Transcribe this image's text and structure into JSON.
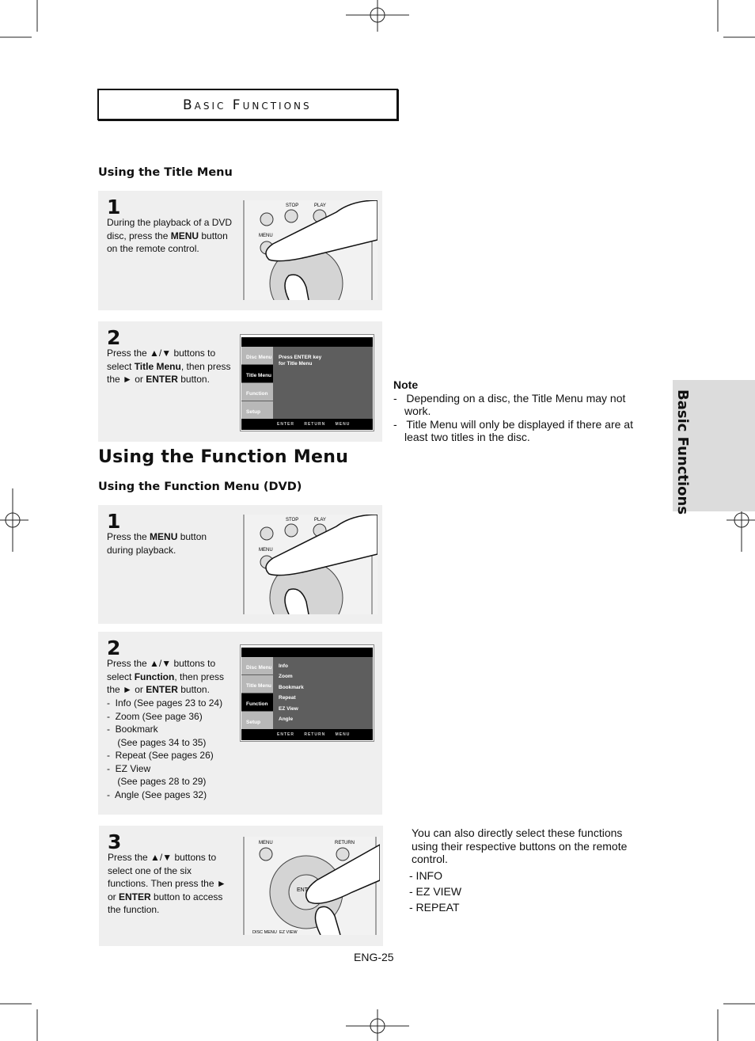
{
  "header": {
    "title": "Basic Functions"
  },
  "side_tab": {
    "label": "Basic Functions"
  },
  "title_menu": {
    "heading": "Using the Title Menu",
    "steps": [
      {
        "num": "1",
        "segments": [
          {
            "t": "During the playback of a DVD disc, press the "
          },
          {
            "t": "MENU",
            "b": true
          },
          {
            "t": " button on the remote control."
          }
        ]
      },
      {
        "num": "2",
        "segments": [
          {
            "t": "Press the ▲/▼ buttons to select "
          },
          {
            "t": "Title Menu",
            "b": true
          },
          {
            "t": ", then press the ► or "
          },
          {
            "t": "ENTER",
            "b": true
          },
          {
            "t": " button."
          }
        ]
      }
    ]
  },
  "function_menu": {
    "heading": "Using the Function Menu",
    "subheading": "Using the Function Menu (DVD)",
    "steps": [
      {
        "num": "1",
        "segments": [
          {
            "t": "Press the "
          },
          {
            "t": "MENU",
            "b": true
          },
          {
            "t": " button during playback."
          }
        ]
      },
      {
        "num": "2",
        "segments": [
          {
            "t": "Press the ▲/▼ buttons to select "
          },
          {
            "t": "Function",
            "b": true
          },
          {
            "t": ", then press the ► or "
          },
          {
            "t": "ENTER",
            "b": true
          },
          {
            "t": " button."
          }
        ],
        "list": [
          "-  Info (See pages 23 to 24)",
          "-  Zoom (See page 36)",
          "-  Bookmark",
          "    (See pages 34 to 35)",
          "-  Repeat (See pages 26)",
          "-  EZ View",
          "    (See pages 28 to 29)",
          "-  Angle (See pages 32)"
        ]
      },
      {
        "num": "3",
        "segments": [
          {
            "t": "Press the ▲/▼ buttons to select one of the six functions. Then press the ► or "
          },
          {
            "t": "ENTER",
            "b": true
          },
          {
            "t": " button to access the function."
          }
        ]
      }
    ]
  },
  "remote": {
    "stop": "STOP",
    "play": "PLAY",
    "menu": "MENU",
    "return": "RETURN",
    "enter": "ENTER",
    "disc_menu": "DISC MENU",
    "ez_view": "EZ VIEW"
  },
  "osd": {
    "side": [
      "Disc Menu",
      "Title Menu",
      "Function",
      "Setup"
    ],
    "title_msg": [
      "Press ENTER key",
      "for Title Menu"
    ],
    "functions": [
      "Info",
      "Zoom",
      "Bookmark",
      "Repeat",
      "EZ View",
      "Angle"
    ],
    "bottom": [
      "ENTER",
      "RETURN",
      "MENU"
    ]
  },
  "note": {
    "title": "Note",
    "items": [
      "Depending on a disc, the Title Menu may not work.",
      "Title Menu will only be displayed if there are at least two titles in the disc."
    ]
  },
  "direct": {
    "text": "You can also directly select these functions using their respective buttons on the remote control.",
    "items": [
      "- INFO",
      "- EZ VIEW",
      "- REPEAT"
    ]
  },
  "page_number": "ENG-25"
}
